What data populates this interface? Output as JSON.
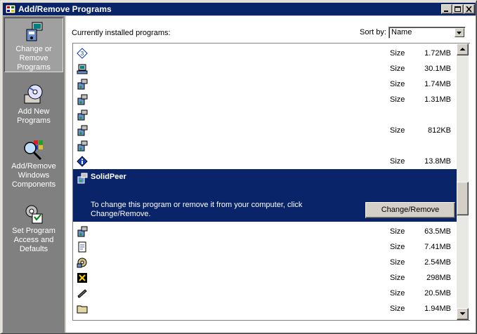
{
  "window": {
    "title": "Add/Remove Programs"
  },
  "sidebar": {
    "items": [
      {
        "label": "Change or Remove Programs",
        "icon": "change-remove-programs-icon",
        "active": true
      },
      {
        "label": "Add New Programs",
        "icon": "add-new-programs-icon",
        "active": false
      },
      {
        "label": "Add/Remove Windows Components",
        "icon": "windows-components-icon",
        "active": false
      },
      {
        "label": "Set Program Access and Defaults",
        "icon": "program-access-defaults-icon",
        "active": false
      }
    ]
  },
  "main": {
    "currently_installed_label": "Currently installed programs:",
    "sort_by_label": "Sort by:",
    "sort_by_value": "Name"
  },
  "programs": [
    {
      "icon": "setup-icon-blue-diamond",
      "size_label": "Size",
      "size": "1.72MB"
    },
    {
      "icon": "computer-setup-icon",
      "size_label": "Size",
      "size": "30.1MB"
    },
    {
      "icon": "installer-package-icon",
      "size_label": "Size",
      "size": "1.74MB"
    },
    {
      "icon": "installer-package-icon",
      "size_label": "Size",
      "size": "1.31MB"
    },
    {
      "icon": "installer-package-icon",
      "size_label": "",
      "size": ""
    },
    {
      "icon": "installer-package-icon",
      "size_label": "Size",
      "size": "812KB"
    },
    {
      "icon": "installer-package-icon",
      "size_label": "",
      "size": ""
    },
    {
      "icon": "info-diamond-icon",
      "size_label": "Size",
      "size": "13.8MB"
    }
  ],
  "selected_program": {
    "name": "SolidPeer",
    "description": "To change this program or remove it from your computer, click Change/Remove.",
    "button_label": "Change/Remove"
  },
  "programs_after": [
    {
      "icon": "installer-package-icon",
      "size_label": "Size",
      "size": "63.5MB"
    },
    {
      "icon": "document-setup-icon",
      "size_label": "Size",
      "size": "7.41MB"
    },
    {
      "icon": "media-disc-icon",
      "size_label": "Size",
      "size": "2.54MB"
    },
    {
      "icon": "black-yellow-app-icon",
      "size_label": "Size",
      "size": "298MB"
    },
    {
      "icon": "pen-app-icon",
      "size_label": "Size",
      "size": "20.5MB"
    },
    {
      "icon": "folder-icon",
      "size_label": "Size",
      "size": "1.94MB"
    }
  ],
  "colors": {
    "titlebar": "#0a246a",
    "selection": "#0a246a",
    "sidebar": "#808080",
    "face": "#d4d0c8"
  }
}
